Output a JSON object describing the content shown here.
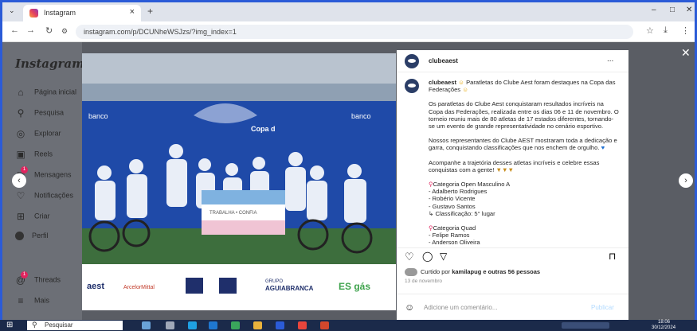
{
  "browser": {
    "tab_title": "Instagram",
    "new_tab": "+",
    "url": "instagram.com/p/DCUNheWSJzs/?img_index=1",
    "window_controls": [
      "–",
      "□",
      "✕"
    ]
  },
  "sidebar": {
    "logo": "Instagram",
    "items": [
      {
        "label": "Página inicial",
        "icon": "home-icon"
      },
      {
        "label": "Pesquisa",
        "icon": "search-icon"
      },
      {
        "label": "Explorar",
        "icon": "compass-icon"
      },
      {
        "label": "Reels",
        "icon": "reels-icon"
      },
      {
        "label": "Mensagens",
        "icon": "messenger-icon",
        "badge": "1"
      },
      {
        "label": "Notificações",
        "icon": "heart-icon"
      },
      {
        "label": "Criar",
        "icon": "plus-square-icon"
      },
      {
        "label": "Perfil",
        "icon": "profile-avatar-icon"
      },
      {
        "label": "Threads",
        "icon": "threads-icon",
        "badge": "1"
      },
      {
        "label": "Mais",
        "icon": "menu-icon"
      }
    ]
  },
  "post": {
    "username": "clubeaest",
    "more": "...",
    "caption": [
      "Paratletas do Clube Aest foram destaques na Copa das Federações",
      "Os paratletas do Clube Aest conquistaram resultados incríveis na Copa das Federações, realizada entre os dias 06 e 11 de novembro. O torneio reuniu mais de 80 atletas de 17 estados diferentes, tornando-se um evento de grande representatividade no cenário esportivo.",
      "Nossos representantes do Clube AEST mostraram toda a dedicação e garra, conquistando classificações que nos enchem de orgulho.",
      "Acompanhe a trajetória desses atletas incríveis e celebre essas conquistas com a gente!"
    ],
    "categories": [
      {
        "title": "Categoria Open Masculino A",
        "lines": [
          "- Adalberto Rodrigues",
          "- Robério Vicente",
          "- Gustavo Santos",
          "↳ Classificação: 5° lugar"
        ]
      },
      {
        "title": "Categoria Quad",
        "lines": [
          "- Felipe Ramos",
          "- Anderson Oliveira"
        ]
      }
    ],
    "liked_by": "Curtido por",
    "liked_user": "kamilapug",
    "liked_rest": "e outras 56 pessoas",
    "date": "13 de novembro",
    "comment_placeholder": "Adicione um comentário...",
    "publish": "Publicar"
  },
  "photo": {
    "banner_text_1": "banco",
    "banner_text_2": "banco",
    "banner_text_3": "Copa d",
    "flag_text": "TRABALHA • CONFIA",
    "sponsors": [
      "aest",
      "ArcelorMittal",
      "GRUPO",
      "AGUIABRANCA",
      "ES gás"
    ]
  },
  "taskbar": {
    "search": "Pesquisar",
    "time": "18:06",
    "date": "30/12/2024"
  },
  "colors": {
    "instagram_blue": "#0095f6",
    "banner_blue": "#1f4aa8",
    "window_border": "#2b5bd7"
  }
}
